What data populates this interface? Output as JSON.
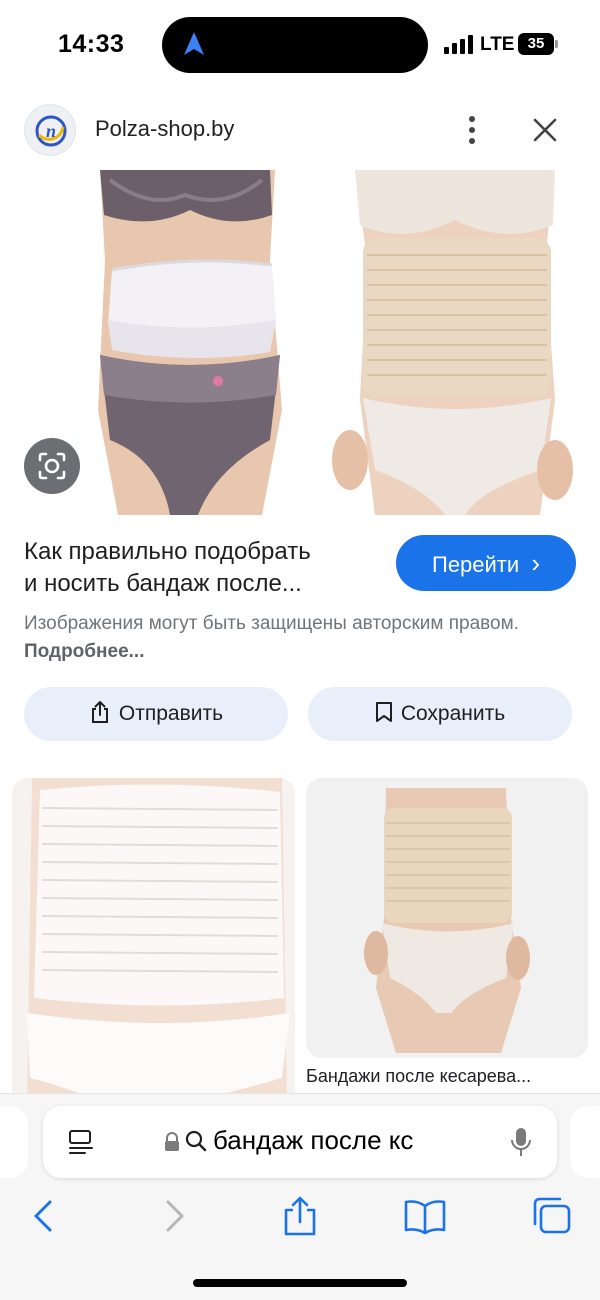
{
  "status_bar": {
    "time": "14:33",
    "network": "LTE",
    "battery": "35"
  },
  "source": {
    "site_name": "Polza-shop.by",
    "logo_letter": "n"
  },
  "result": {
    "title_line1": "Как правильно подобрать",
    "title_line2": "и носить бандаж после...",
    "visit_label": "Перейти",
    "visit_chevron": "›",
    "copyright_text": "Изображения могут быть защищены авторским правом.",
    "more_link": "Подробнее..."
  },
  "actions": {
    "share_label": "Отправить",
    "save_label": "Сохранить"
  },
  "grid": {
    "caption_right": "Бандажи после кесарева..."
  },
  "browser": {
    "query": "бандаж после кс"
  },
  "colors": {
    "accent": "#1a73e8",
    "chip_bg": "#e8eefa",
    "muted": "#70757a"
  }
}
